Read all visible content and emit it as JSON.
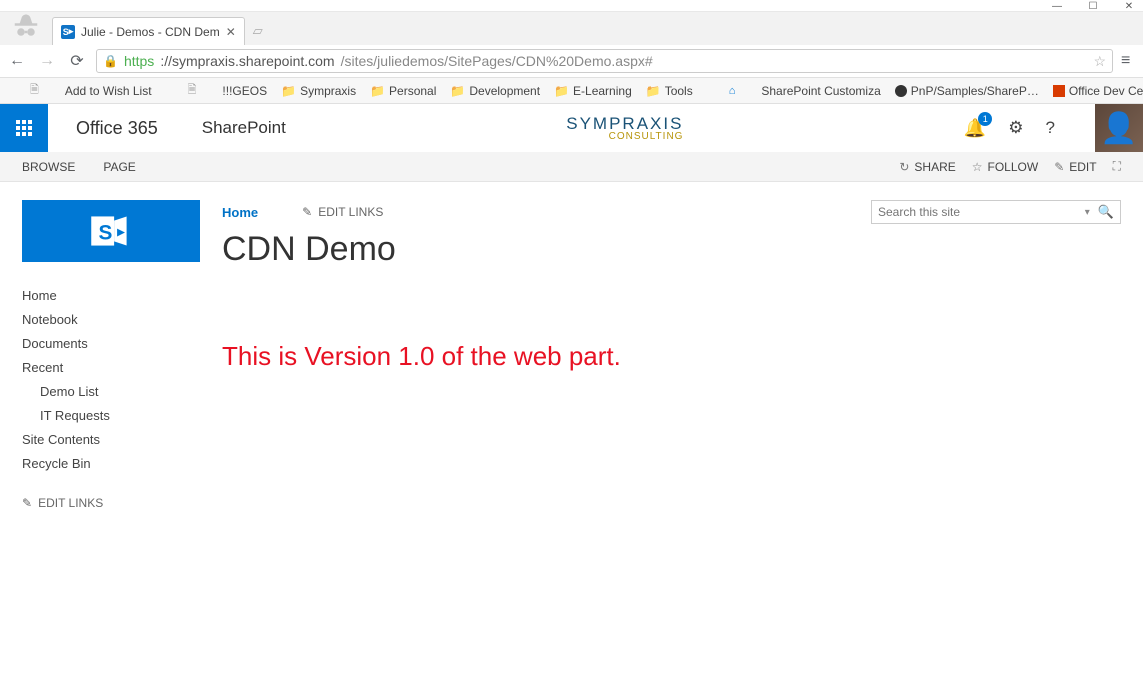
{
  "window": {
    "minimize": "—",
    "maximize": "☐",
    "close": "✕"
  },
  "browser": {
    "tab_title": "Julie - Demos - CDN Dem",
    "favicon_letter": "S",
    "url_protocol": "https",
    "url_host": "://sympraxis.sharepoint.com",
    "url_path": "/sites/juliedemos/SitePages/CDN%20Demo.aspx#",
    "bookmarks": [
      {
        "label": "Add to Wish List",
        "kind": "page"
      },
      {
        "label": "!!!GEOS",
        "kind": "page"
      },
      {
        "label": "Sympraxis",
        "kind": "folder"
      },
      {
        "label": "Personal",
        "kind": "folder"
      },
      {
        "label": "Development",
        "kind": "folder"
      },
      {
        "label": "E-Learning",
        "kind": "folder"
      },
      {
        "label": "Tools",
        "kind": "folder"
      },
      {
        "label": "SharePoint Customiza",
        "kind": "sp"
      },
      {
        "label": "PnP/Samples/ShareP…",
        "kind": "gh"
      },
      {
        "label": "Office Dev Center - Fa",
        "kind": "od"
      }
    ]
  },
  "suitebar": {
    "brand": "Office 365",
    "app": "SharePoint",
    "logo_line1": "SYMPRAXIS",
    "logo_line2": "CONSULTING",
    "notifications_count": "1"
  },
  "ribbon": {
    "left": [
      "BROWSE",
      "PAGE"
    ],
    "right": [
      {
        "icon": "↻",
        "label": "SHARE"
      },
      {
        "icon": "☆",
        "label": "FOLLOW"
      },
      {
        "icon": "✎",
        "label": "EDIT"
      },
      {
        "icon": "⛶",
        "label": ""
      }
    ]
  },
  "topnav": {
    "home": "Home",
    "edit_links": "EDIT LINKS",
    "search_placeholder": "Search this site"
  },
  "page_title": "CDN Demo",
  "quicklaunch": {
    "items": [
      {
        "label": "Home",
        "sub": false
      },
      {
        "label": "Notebook",
        "sub": false
      },
      {
        "label": "Documents",
        "sub": false
      },
      {
        "label": "Recent",
        "sub": false
      },
      {
        "label": "Demo List",
        "sub": true
      },
      {
        "label": "IT Requests",
        "sub": true
      },
      {
        "label": "Site Contents",
        "sub": false
      },
      {
        "label": "Recycle Bin",
        "sub": false
      }
    ],
    "edit_links": "EDIT LINKS"
  },
  "webpart_text": "This is Version 1.0 of the web part."
}
